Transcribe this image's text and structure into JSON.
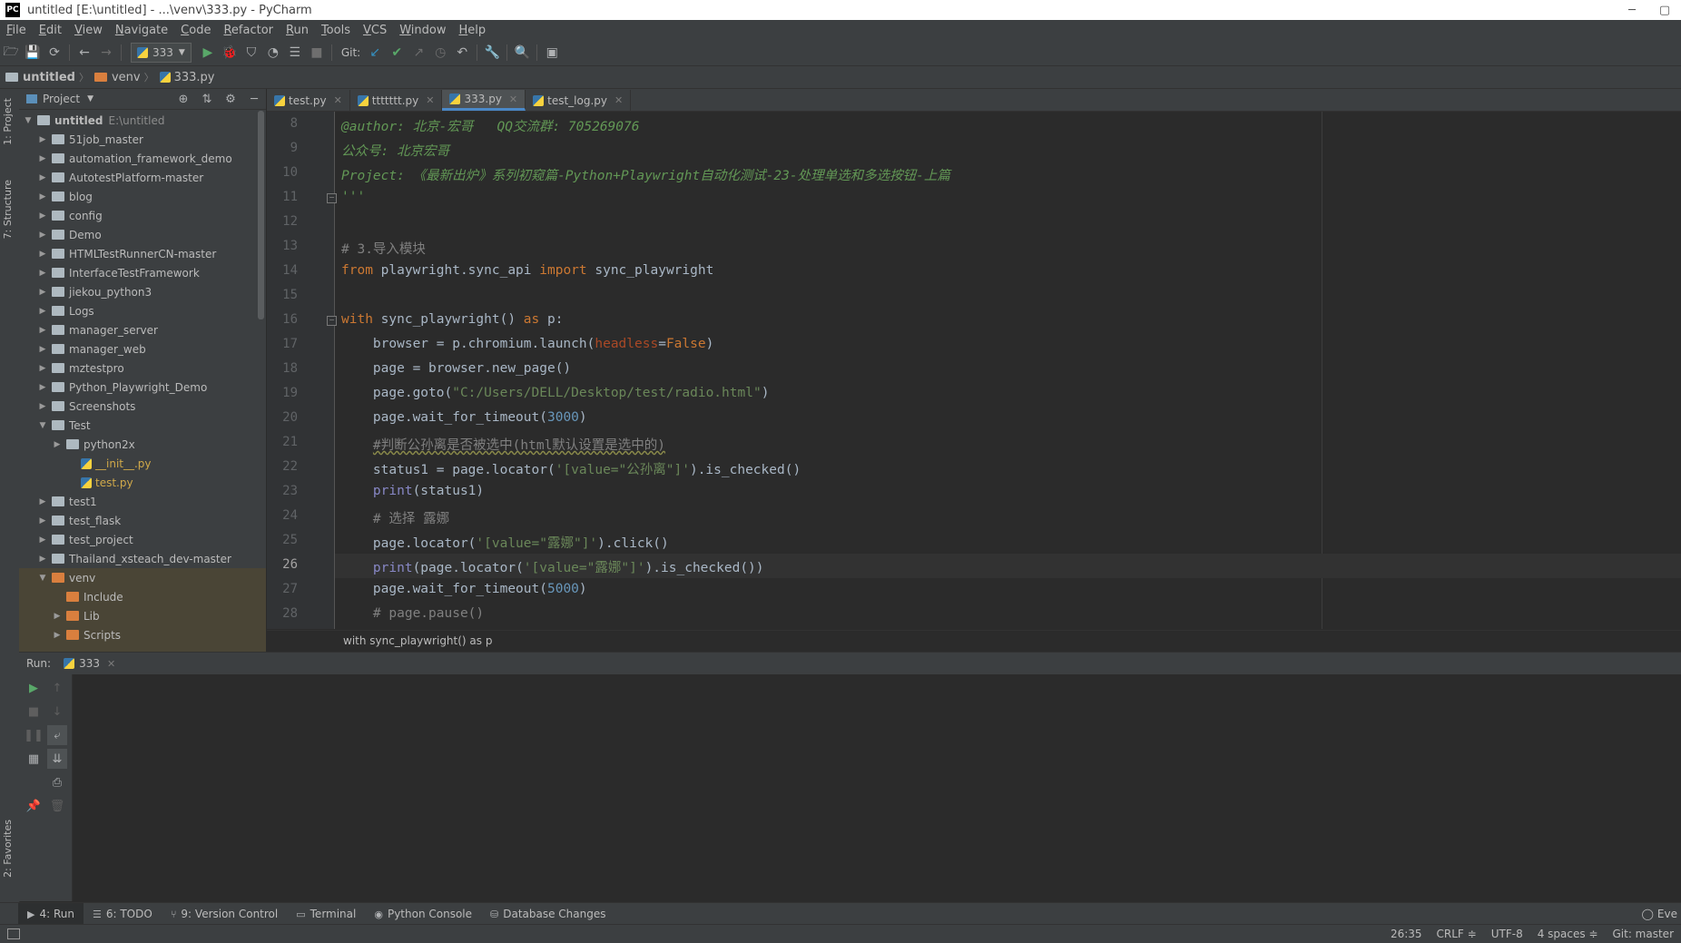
{
  "window": {
    "title": "untitled [E:\\untitled] - ...\\venv\\333.py - PyCharm",
    "logo": "PC"
  },
  "menu": [
    "File",
    "Edit",
    "View",
    "Navigate",
    "Code",
    "Refactor",
    "Run",
    "Tools",
    "VCS",
    "Window",
    "Help"
  ],
  "toolbar": {
    "run_config": "333",
    "git_label": "Git:"
  },
  "breadcrumb": [
    "untitled",
    "venv",
    "333.py"
  ],
  "left_strip": {
    "project_tab": "1: Project",
    "structure_tab": "7: Structure",
    "favorites_tab": "2: Favorites"
  },
  "project_panel": {
    "title": "Project",
    "root": {
      "name": "untitled",
      "path": "E:\\untitled"
    },
    "items": [
      {
        "name": "51job_master",
        "level": 1,
        "expanded": false,
        "type": "folder"
      },
      {
        "name": "automation_framework_demo",
        "level": 1,
        "expanded": false,
        "type": "folder"
      },
      {
        "name": "AutotestPlatform-master",
        "level": 1,
        "expanded": false,
        "type": "folder"
      },
      {
        "name": "blog",
        "level": 1,
        "expanded": false,
        "type": "folder"
      },
      {
        "name": "config",
        "level": 1,
        "expanded": false,
        "type": "folder"
      },
      {
        "name": "Demo",
        "level": 1,
        "expanded": false,
        "type": "folder"
      },
      {
        "name": "HTMLTestRunnerCN-master",
        "level": 1,
        "expanded": false,
        "type": "folder"
      },
      {
        "name": "InterfaceTestFramework",
        "level": 1,
        "expanded": false,
        "type": "folder"
      },
      {
        "name": "jiekou_python3",
        "level": 1,
        "expanded": false,
        "type": "folder"
      },
      {
        "name": "Logs",
        "level": 1,
        "expanded": false,
        "type": "folder"
      },
      {
        "name": "manager_server",
        "level": 1,
        "expanded": false,
        "type": "folder"
      },
      {
        "name": "manager_web",
        "level": 1,
        "expanded": false,
        "type": "folder"
      },
      {
        "name": "mztestpro",
        "level": 1,
        "expanded": false,
        "type": "folder"
      },
      {
        "name": "Python_Playwright_Demo",
        "level": 1,
        "expanded": false,
        "type": "folder"
      },
      {
        "name": "Screenshots",
        "level": 1,
        "expanded": false,
        "type": "folder"
      },
      {
        "name": "Test",
        "level": 1,
        "expanded": true,
        "type": "folder"
      },
      {
        "name": "python2x",
        "level": 2,
        "expanded": false,
        "type": "folder"
      },
      {
        "name": "__init__.py",
        "level": 3,
        "type": "pyfile"
      },
      {
        "name": "test.py",
        "level": 3,
        "type": "pyfile"
      },
      {
        "name": "test1",
        "level": 1,
        "expanded": false,
        "type": "folder"
      },
      {
        "name": "test_flask",
        "level": 1,
        "expanded": false,
        "type": "folder"
      },
      {
        "name": "test_project",
        "level": 1,
        "expanded": false,
        "type": "folder"
      },
      {
        "name": "Thailand_xsteach_dev-master",
        "level": 1,
        "expanded": false,
        "type": "folder"
      },
      {
        "name": "venv",
        "level": 1,
        "expanded": true,
        "type": "venv"
      },
      {
        "name": "Include",
        "level": 2,
        "type": "venvfolder",
        "noarrow": true
      },
      {
        "name": "Lib",
        "level": 2,
        "expanded": false,
        "type": "venvfolder"
      },
      {
        "name": "Scripts",
        "level": 2,
        "expanded": false,
        "type": "venvfolder"
      }
    ]
  },
  "editor_tabs": [
    {
      "label": "test.py",
      "active": false
    },
    {
      "label": "ttttttt.py",
      "active": false
    },
    {
      "label": "333.py",
      "active": true
    },
    {
      "label": "test_log.py",
      "active": false
    }
  ],
  "code_lines": [
    {
      "num": "8",
      "html": "<span class='c-doc'>@author: 北京-宏哥   QQ交流群: 705269076</span>"
    },
    {
      "num": "9",
      "html": "<span class='c-doc'>公众号: 北京宏哥</span>"
    },
    {
      "num": "10",
      "html": "<span class='c-doc'>Project: 《最新出炉》系列初窥篇-Python+Playwright自动化测试-23-处理单选和多选按钮-上篇</span>"
    },
    {
      "num": "11",
      "html": "<span class='c-doc'>'''</span>",
      "fold": true
    },
    {
      "num": "12",
      "html": ""
    },
    {
      "num": "13",
      "html": "<span class='c-com'># 3.导入模块</span>"
    },
    {
      "num": "14",
      "html": "<span class='c-kw'>from</span> playwright.sync_api <span class='c-kw'>import</span> sync_playwright"
    },
    {
      "num": "15",
      "html": ""
    },
    {
      "num": "16",
      "html": "<span class='c-kw'>with</span> sync_playwright() <span class='c-kw'>as</span> p:",
      "fold": true
    },
    {
      "num": "17",
      "html": "    browser = p.chromium.launch(<span class='c-param'>headless</span>=<span class='c-kw'>False</span>)"
    },
    {
      "num": "18",
      "html": "    page = browser.new_page()"
    },
    {
      "num": "19",
      "html": "    page.goto(<span class='c-str'>\"C:/Users/DELL/Desktop/test/radio.html\"</span>)"
    },
    {
      "num": "20",
      "html": "    page.wait_for_timeout(<span class='c-num'>3000</span>)"
    },
    {
      "num": "21",
      "html": "    <span class='c-com squig'>#判断公孙离是否被选中(html默认设置是选中的)</span>"
    },
    {
      "num": "22",
      "html": "    status1 = page.locator(<span class='c-str'>'[value=\"公孙离\"]'</span>).is_checked()"
    },
    {
      "num": "23",
      "html": "    <span class='c-builtin'>print</span>(status1)"
    },
    {
      "num": "24",
      "html": "    <span class='c-com'># 选择 露娜</span>"
    },
    {
      "num": "25",
      "html": "    page.locator(<span class='c-str'>'[value=\"露娜\"]'</span>).click()"
    },
    {
      "num": "26",
      "html": "    <span class='c-builtin'>print</span>(page.locator(<span class='c-str'>'[value=\"露娜\"]'</span>).is_checked())",
      "current": true
    },
    {
      "num": "27",
      "html": "    page.wait_for_timeout(<span class='c-num'>5000</span>)"
    },
    {
      "num": "28",
      "html": "    <span class='c-com'># page.pause()</span>"
    }
  ],
  "editor_status": "with sync_playwright() as p",
  "run_panel": {
    "label": "Run:",
    "tab": "333"
  },
  "tool_windows": [
    {
      "label": "4: Run",
      "icon": "▶",
      "active": true
    },
    {
      "label": "6: TODO",
      "icon": "☰",
      "active": false
    },
    {
      "label": "9: Version Control",
      "icon": "⑂",
      "active": false
    },
    {
      "label": "Terminal",
      "icon": "▭",
      "active": false
    },
    {
      "label": "Python Console",
      "icon": "◉",
      "active": false
    },
    {
      "label": "Database Changes",
      "icon": "⛁",
      "active": false
    }
  ],
  "event_log": "Eve",
  "status_bar": {
    "position": "26:35",
    "line_sep": "CRLF ≑",
    "encoding": "UTF-8",
    "indent": "4 spaces ≑",
    "git": "Git: master"
  },
  "colors": {
    "folder": "#aeb9c0",
    "venv_folder": "#d97f3e",
    "accent": "#4a88c7"
  }
}
